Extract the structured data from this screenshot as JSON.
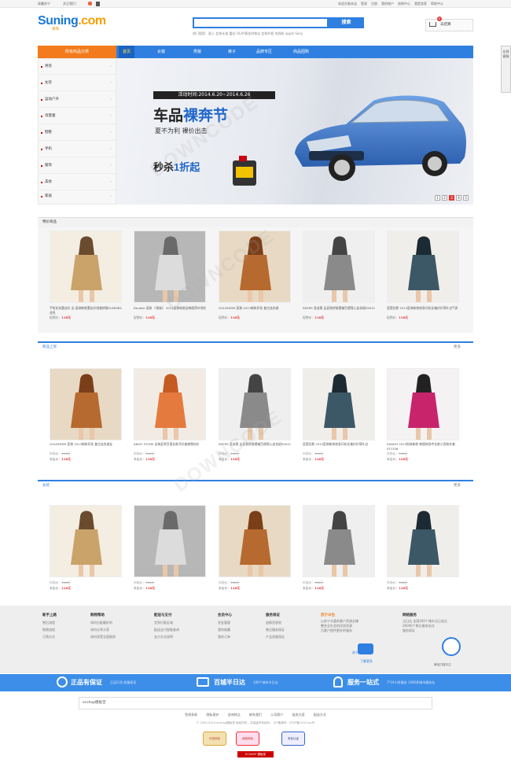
{
  "topbar": {
    "left": [
      "收藏苏宁",
      "关注我们：",
      "手机苏宁"
    ],
    "right": [
      "欢迎光临本店",
      "登录",
      "注册",
      "我的账户",
      "选购中心",
      "我是卖家",
      "帮助中心"
    ]
  },
  "logo": {
    "main": "Suning",
    "dot": ".com",
    "sub": "易购"
  },
  "search": {
    "placeholder": "",
    "button": "搜索",
    "hot": "热门搜索：夏士  女装长裙  蕾丝  OLAY黄金时装店  女装外套  电视机  apple  Sony"
  },
  "cart": {
    "label": "去结算",
    "count": "0"
  },
  "nav": {
    "category": "所有商品分类",
    "items": [
      "首页",
      "女装",
      "男装",
      "裤子",
      "品牌专区",
      "商品团购"
    ]
  },
  "sidebar": {
    "items": [
      "男装",
      "女装",
      "运动户外",
      "母婴童",
      "鞋靴",
      "手机",
      "服饰",
      "美妆",
      "家居"
    ]
  },
  "banner": {
    "activity": "活动时间:2014.6.20~2014.6.26",
    "title_a": "车品",
    "title_b": "裸奔节",
    "subtitle": "夏不为利  裸价出击",
    "promo_a": "秒杀",
    "promo_b": "1折起",
    "dots": [
      "1",
      "2",
      "3",
      "4",
      "5"
    ],
    "active_dot": "3"
  },
  "sections": [
    {
      "title": "特价商品",
      "more": "",
      "products": [
        {
          "name": "手绘花朵蕾丝衫 女 夏装新款蕾丝衫短袖拼接ELBD584 花色",
          "price_label": "促销价：",
          "price": "118元"
        },
        {
          "name": "Doublie 夏装 《贵族》 2013夏装新款女韩版荷叶领衫",
          "price_label": "促销价：",
          "price": "118元"
        },
        {
          "name": "GOLDFARM 夏装 2013新款印花 复古连衣裙",
          "price_label": "促销价：",
          "price": "118元"
        },
        {
          "name": "SDEER 圣迪奥 女夏装拼接褶皱百褶背心连衣裙S2812",
          "price_label": "促销价：",
          "price": "118元"
        },
        {
          "name": "夏茜拉斯 2013夏装新款修身印花长袖衬衫荷叶边气质",
          "price_label": "促销价：",
          "price": "118元"
        }
      ]
    },
    {
      "title": "新品上架",
      "more": "更多",
      "products": [
        {
          "name": "GOLDFARM 夏装 2013新款印花 复古连衣裙女",
          "old_label": "市场价：",
          "old": "144元",
          "price_label": "本店价：",
          "price": "118元"
        },
        {
          "name": "ANOO STORE 女装夏季百搭长款开衫披肩雪纺衫",
          "old_label": "市场价：",
          "old": "144元",
          "price_label": "本店价：",
          "price": "118元"
        },
        {
          "name": "SDEER 圣迪奥 女夏装拼接褶皱百褶背心连衣裙S2812",
          "old_label": "市场价：",
          "old": "144元",
          "price_label": "本店价：",
          "price": "118元"
        },
        {
          "name": "夏茜拉斯 2013夏装新款修身印花长袖衬衫荷叶边",
          "old_label": "市场价：",
          "old": "144元",
          "price_label": "本店价：",
          "price": "118元"
        },
        {
          "name": "SANGYI 2013秋装新款 韩版修身中长款小西装外套ST1338",
          "old_label": "市场价：",
          "old": "144元",
          "price_label": "本店价：",
          "price": "128元"
        }
      ]
    },
    {
      "title": "女装",
      "more": "更多",
      "products": [
        {
          "name": "",
          "old_label": "市场价：",
          "old": "144元",
          "price_label": "本店价：",
          "price": "118元"
        },
        {
          "name": "",
          "old_label": "市场价：",
          "old": "144元",
          "price_label": "本店价：",
          "price": "118元"
        },
        {
          "name": "",
          "old_label": "市场价：",
          "old": "144元",
          "price_label": "本店价：",
          "price": "118元"
        },
        {
          "name": "",
          "old_label": "市场价：",
          "old": "144元",
          "price_label": "本店价：",
          "price": "118元"
        },
        {
          "name": "",
          "old_label": "市场价：",
          "old": "144元",
          "price_label": "本店价：",
          "price": "118元"
        }
      ]
    }
  ],
  "footer": {
    "columns": [
      {
        "title": "新手上路",
        "links": [
          "售后流程",
          "购物流程",
          "订购方式"
        ]
      },
      {
        "title": "购物帮助",
        "links": [
          "如何分配最好的",
          "如何分享大家",
          "如何享受全国联保"
        ]
      },
      {
        "title": "配送与支付",
        "links": [
          "货到付款区域",
          "配送支付智能查询",
          "支付方式说明"
        ]
      },
      {
        "title": "会员中心",
        "links": [
          "资金管理",
          "我的收藏",
          "我的订单"
        ]
      },
      {
        "title": "服务保证",
        "links": [
          "退换货原则",
          "售后服务保证",
          "产品质量保证"
        ]
      },
      {
        "title": "苏宁众包",
        "links": [
          "以苏宁丰富的客户资源支撑",
          "整合全社会的优质资源",
          "为客户提供更好的服务"
        ]
      },
      {
        "title": "网络服务",
        "links": [
          "当日达 全国200个城市当日送达",
          "26000个售后服务站点",
          "服务保证"
        ]
      }
    ],
    "crowd_label": "苏宁众包",
    "crowd_more": "了解更多",
    "service_label": "微信扫描关注",
    "banner_items": [
      {
        "title": "正品有保证",
        "sub": "正品行货  质量保证"
      },
      {
        "title": "百城半日达",
        "sub": "100个城市半日达"
      },
      {
        "title": "服务一站式",
        "sub": "7*24小时服务 1000多城市服务站"
      }
    ],
    "search_value": "ecshop模板堂",
    "links": [
      "免责条款",
      "隐私保护",
      "咨询热点",
      "联系我们",
      "公司简介",
      "批发方案",
      "配送方式"
    ],
    "copyright": "© 2005-2014 ecshop模板堂 版权所有，并保留所有权利。  ICP备案号：沪ICP备12011xx号",
    "badges": [
      "可信网站",
      "诚信网站",
      "安全认证"
    ],
    "powered": "ECSHOP 模板堂"
  },
  "sidetab": {
    "text": "在线客服"
  },
  "colors": {
    "primary": "#2f7fe0",
    "orange": "#f37b1d",
    "price": "#e4393c"
  }
}
